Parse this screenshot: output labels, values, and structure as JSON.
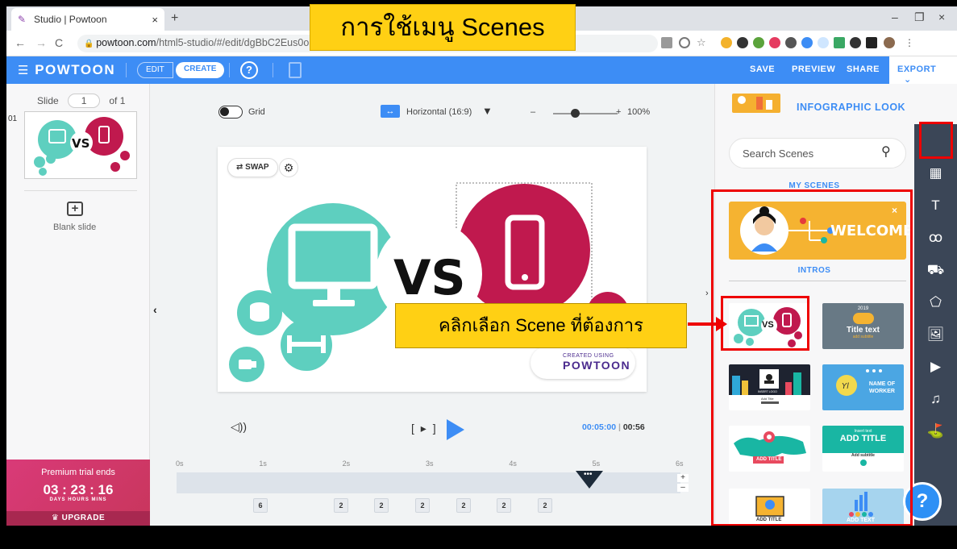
{
  "browser": {
    "tab_title": "Studio | Powtoon",
    "tab_close": "×",
    "new_tab": "+",
    "url_domain": "powtoon.com",
    "url_path": "/html5-studio/#/edit/dgBbC2Eus0o",
    "back": "←",
    "forward": "→",
    "reload": "C",
    "window_minimize": "–",
    "window_maximize": "❐",
    "window_close": "×"
  },
  "toolbar": {
    "logo": "POWTOON",
    "edit": "EDIT",
    "create": "CREATE",
    "help": "?",
    "save": "SAVE",
    "preview": "PREVIEW",
    "share": "SHARE",
    "export": "EXPORT",
    "export_caret": "⌄"
  },
  "overlay_title": "การใช้เมนู Scenes",
  "left_panel": {
    "slide_label": "Slide",
    "slide_value": "1",
    "slide_of": "of 1",
    "slide_index": "01",
    "blank_slide_icon": "+",
    "blank_slide": "Blank slide",
    "premium_title": "Premium trial ends",
    "countdown": "03 : 23 : 16",
    "countdown_labels": "DAYS   HOURS   MINS",
    "upgrade": "UPGRADE"
  },
  "canvas": {
    "grid_label": "Grid",
    "orientation": "Horizontal (16:9)",
    "orientation_icon": "↔",
    "zoom_minus": "–",
    "zoom_plus": "+",
    "zoom_value": "100%",
    "swap": "⇄ SWAP",
    "settings": "⚙",
    "vs_text": "VS",
    "created_line1": "CREATED USING",
    "created_line2": "POWTOON",
    "collapse_left": "‹",
    "collapse_right": "›"
  },
  "playback": {
    "volume_icon": "◁))",
    "bracket_play": "[ ▸ ]",
    "time_current": "00:05:00",
    "time_separator": " | ",
    "time_total": "00:56"
  },
  "timeline": {
    "ticks": [
      "0s",
      "1s",
      "2s",
      "3s",
      "4s",
      "5s",
      "6s"
    ],
    "durations": [
      "6",
      "2",
      "2",
      "2",
      "2",
      "2",
      "2"
    ],
    "playhead_dots": "•••",
    "zoom_in": "+",
    "zoom_out": "–"
  },
  "right_panel": {
    "look_label": "INFOGRAPHIC LOOK",
    "look_caret": "▼",
    "search_placeholder": "Search Scenes",
    "search_icon": "⚲",
    "my_scenes": "MY SCENES",
    "welcome": "WELCOME",
    "welcome_close": "×",
    "intros": "INTROS",
    "scenes": [
      {
        "vs": "VS"
      },
      {
        "year": "2019",
        "title": "Title text",
        "subtitle": "add subtitle"
      },
      {
        "label": "INSERT LOGO",
        "title": "Add Title"
      },
      {
        "title": "NAME OF WORKER"
      },
      {
        "title": "ADD TITLE"
      },
      {
        "label": "Insert text",
        "title": "ADD TITLE",
        "subtitle": "Add subtitle"
      },
      {
        "title": "ADD TITLE"
      },
      {
        "title": "ADD TEXT"
      }
    ]
  },
  "rail": {
    "icons": [
      "layout-icon",
      "background-icon",
      "text-icon",
      "characters-icon",
      "props-icon",
      "shapes-icon",
      "images-icon",
      "video-icon",
      "music-icon",
      "specials-icon"
    ],
    "glyphs": [
      "",
      "▦",
      "T",
      "ꝏ",
      "⛟",
      "⬠",
      "🖼",
      "▶",
      "♫",
      "⛳"
    ],
    "help": "?"
  },
  "callout": "คลิกเลือก Scene ที่ต้องการ",
  "colors": {
    "accent": "#3d8df5",
    "teal": "#5ecfbf",
    "crimson": "#c0194e",
    "highlight": "#ffd014",
    "annotation_red": "#ee0000"
  }
}
